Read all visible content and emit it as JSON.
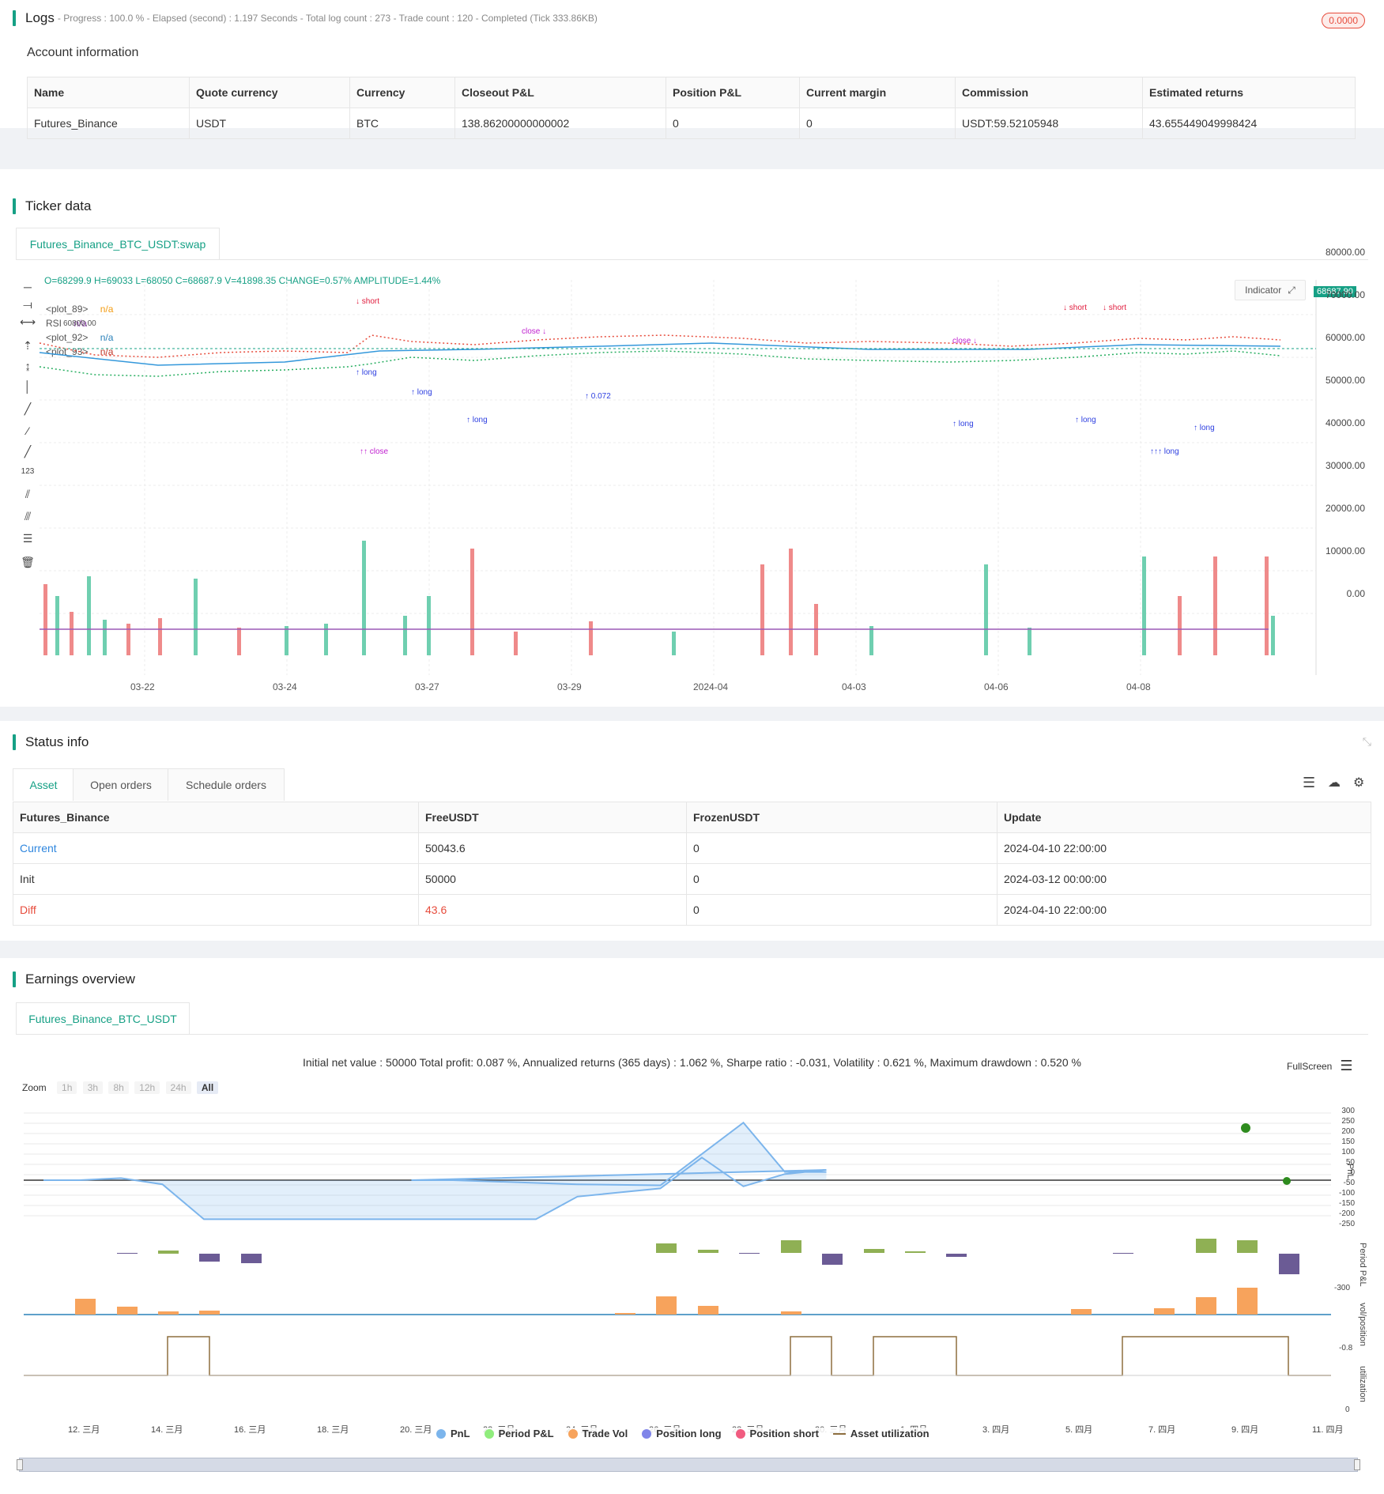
{
  "logs": {
    "title": "Logs",
    "progress": "- Progress : 100.0 % - Elapsed (second) : 1.197  Seconds - Total log count : 273 - Trade count : 120 - Completed (Tick 333.86KB)",
    "badge": "0.0000"
  },
  "account": {
    "title": "Account information",
    "headers": [
      "Name",
      "Quote currency",
      "Currency",
      "Closeout P&L",
      "Position P&L",
      "Current margin",
      "Commission",
      "Estimated returns"
    ],
    "row": [
      "Futures_Binance",
      "USDT",
      "BTC",
      "138.86200000000002",
      "0",
      "0",
      "USDT:59.52105948",
      "43.655449049998424"
    ]
  },
  "ticker": {
    "title": "Ticker data",
    "tab": "Futures_Binance_BTC_USDT:swap",
    "ohlc": "O=68299.9 H=69033 L=68050 C=68687.9 V=41898.35 CHANGE=0.57% AMPLITUDE=1.44%",
    "indicator_button": "Indicator",
    "legend": [
      {
        "name": "<plot_89>",
        "value": "n/a",
        "color": "#f39c12"
      },
      {
        "name": "RSI",
        "value": "n/a",
        "color": "#8e44ad"
      },
      {
        "name": "<plot_92>",
        "value": "n/a",
        "color": "#2980b9"
      },
      {
        "name": "<plot_93>",
        "value": "n/a",
        "color": "#c0392b"
      }
    ],
    "price_label": "68687.90",
    "low_label": "60800.00",
    "y_ticks": [
      "80000.00",
      "70000.00",
      "60000.00",
      "50000.00",
      "40000.00",
      "30000.00",
      "20000.00",
      "10000.00",
      "0.00"
    ],
    "x_ticks": [
      "03-22",
      "03-24",
      "03-27",
      "03-29",
      "2024-04",
      "04-03",
      "04-06",
      "04-08"
    ]
  },
  "status": {
    "title": "Status info",
    "tabs": [
      "Asset",
      "Open orders",
      "Schedule orders"
    ],
    "headers": [
      "Futures_Binance",
      "FreeUSDT",
      "FrozenUSDT",
      "Update"
    ],
    "rows": [
      [
        "Current",
        "50043.6",
        "0",
        "2024-04-10 22:00:00"
      ],
      [
        "Init",
        "50000",
        "0",
        "2024-03-12 00:00:00"
      ],
      [
        "Diff",
        "43.6",
        "0",
        "2024-04-10 22:00:00"
      ]
    ]
  },
  "earnings": {
    "title": "Earnings overview",
    "tab": "Futures_Binance_BTC_USDT",
    "summary": "Initial net value : 50000 Total profit: 0.087 %, Annualized returns (365 days) : 1.062 %, Sharpe ratio : -0.031, Volatility : 0.621 %, Maximum drawdown : 0.520 %",
    "fullscreen": "FullScreen",
    "zoom_label": "Zoom",
    "zoom_options": [
      "1h",
      "3h",
      "8h",
      "12h",
      "24h",
      "All"
    ],
    "pnl_ticks": [
      "300",
      "250",
      "200",
      "150",
      "100",
      "50",
      "0",
      "-50",
      "-100",
      "-150",
      "-200",
      "-250"
    ],
    "axis_titles": [
      "PnL",
      "Period P&L",
      "vol/position",
      "utilization"
    ],
    "period_tick": "-300",
    "vol_tick": "-0.8",
    "util_tick": "0",
    "x_ticks": [
      "12. 三月",
      "14. 三月",
      "16. 三月",
      "18. 三月",
      "20. 三月",
      "22. 三月",
      "24. 三月",
      "26. 三月",
      "28. 三月",
      "30. 三月",
      "1. 四月",
      "3. 四月",
      "5. 四月",
      "7. 四月",
      "9. 四月",
      "11. 四月"
    ],
    "legend": [
      {
        "name": "PnL",
        "color": "#7cb5ec"
      },
      {
        "name": "Period P&L",
        "color": "#90ed7d"
      },
      {
        "name": "Trade Vol",
        "color": "#f7a35c"
      },
      {
        "name": "Position long",
        "color": "#8085e9"
      },
      {
        "name": "Position short",
        "color": "#f15c80"
      },
      {
        "name": "Asset utilization",
        "color": "#8d6e3f"
      }
    ]
  },
  "chart_data": {
    "type": "line",
    "series": [
      {
        "name": "PnL",
        "x": [
          "12. 三月",
          "13. 三月",
          "14. 三月",
          "15. 三月",
          "16. 三月",
          "24. 三月",
          "25. 三月",
          "27. 三月",
          "28. 三月",
          "29. 三月",
          "30. 三月",
          "31. 三月",
          "1. 四月",
          "2. 四月",
          "5. 四月",
          "7. 四月",
          "9. 四月",
          "10. 四月",
          "11. 四月"
        ],
        "values": [
          0,
          0,
          10,
          -20,
          -190,
          -190,
          -80,
          -40,
          110,
          -30,
          30,
          50,
          0,
          0,
          -20,
          -25,
          280,
          40,
          40
        ]
      }
    ],
    "ylim": [
      -250,
      300
    ]
  }
}
